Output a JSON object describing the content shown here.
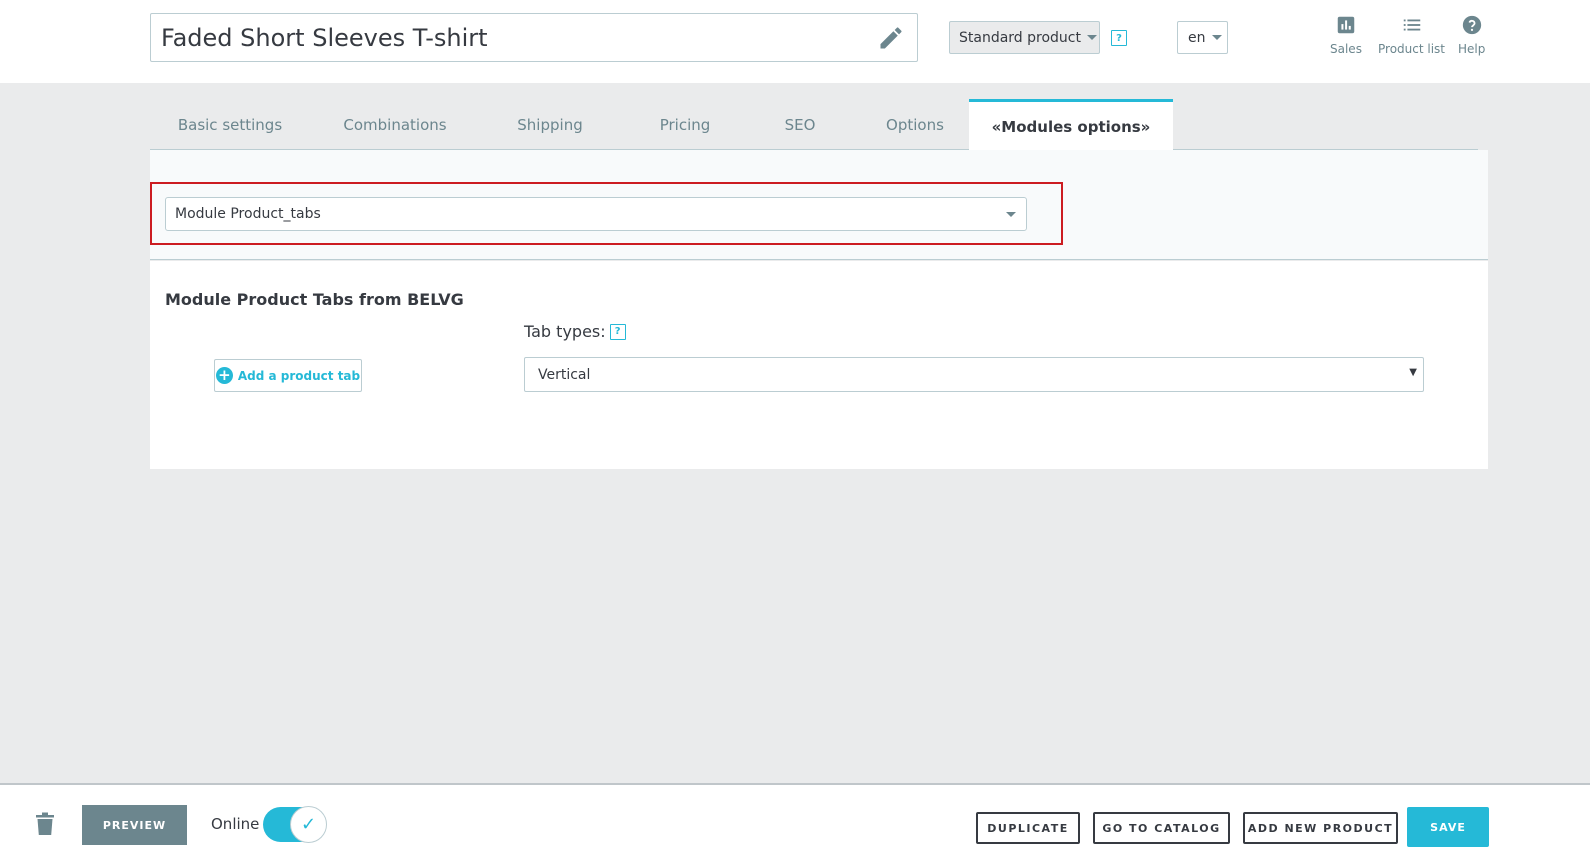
{
  "header": {
    "product_name": "Faded Short Sleeves T-shirt",
    "product_type": "Standard product",
    "help_glyph": "?",
    "language": "en",
    "quick_links": [
      {
        "label": "Sales",
        "icon": "bar-chart-icon"
      },
      {
        "label": "Product list",
        "icon": "list-icon"
      },
      {
        "label": "Help",
        "icon": "help-circle-icon"
      }
    ]
  },
  "tabs": [
    {
      "label": "Basic settings"
    },
    {
      "label": "Combinations"
    },
    {
      "label": "Shipping"
    },
    {
      "label": "Pricing"
    },
    {
      "label": "SEO"
    },
    {
      "label": "Options"
    },
    {
      "label": "«Modules options»",
      "active": true
    }
  ],
  "modules": {
    "selected_module": "Module Product_tabs",
    "section_title": "Module Product Tabs from BELVG",
    "add_tab_label": "Add a product tab",
    "tab_types_label": "Tab types:",
    "tab_types_value": "Vertical"
  },
  "footer": {
    "preview_label": "PREVIEW",
    "online_label": "Online",
    "online": true,
    "duplicate_label": "DUPLICATE",
    "catalog_label": "GO TO CATALOG",
    "add_new_label": "ADD NEW PRODUCT",
    "save_label": "SAVE"
  },
  "colors": {
    "accent": "#25b9d7",
    "highlight_border": "#cc1c21",
    "muted_button": "#6c868e"
  }
}
